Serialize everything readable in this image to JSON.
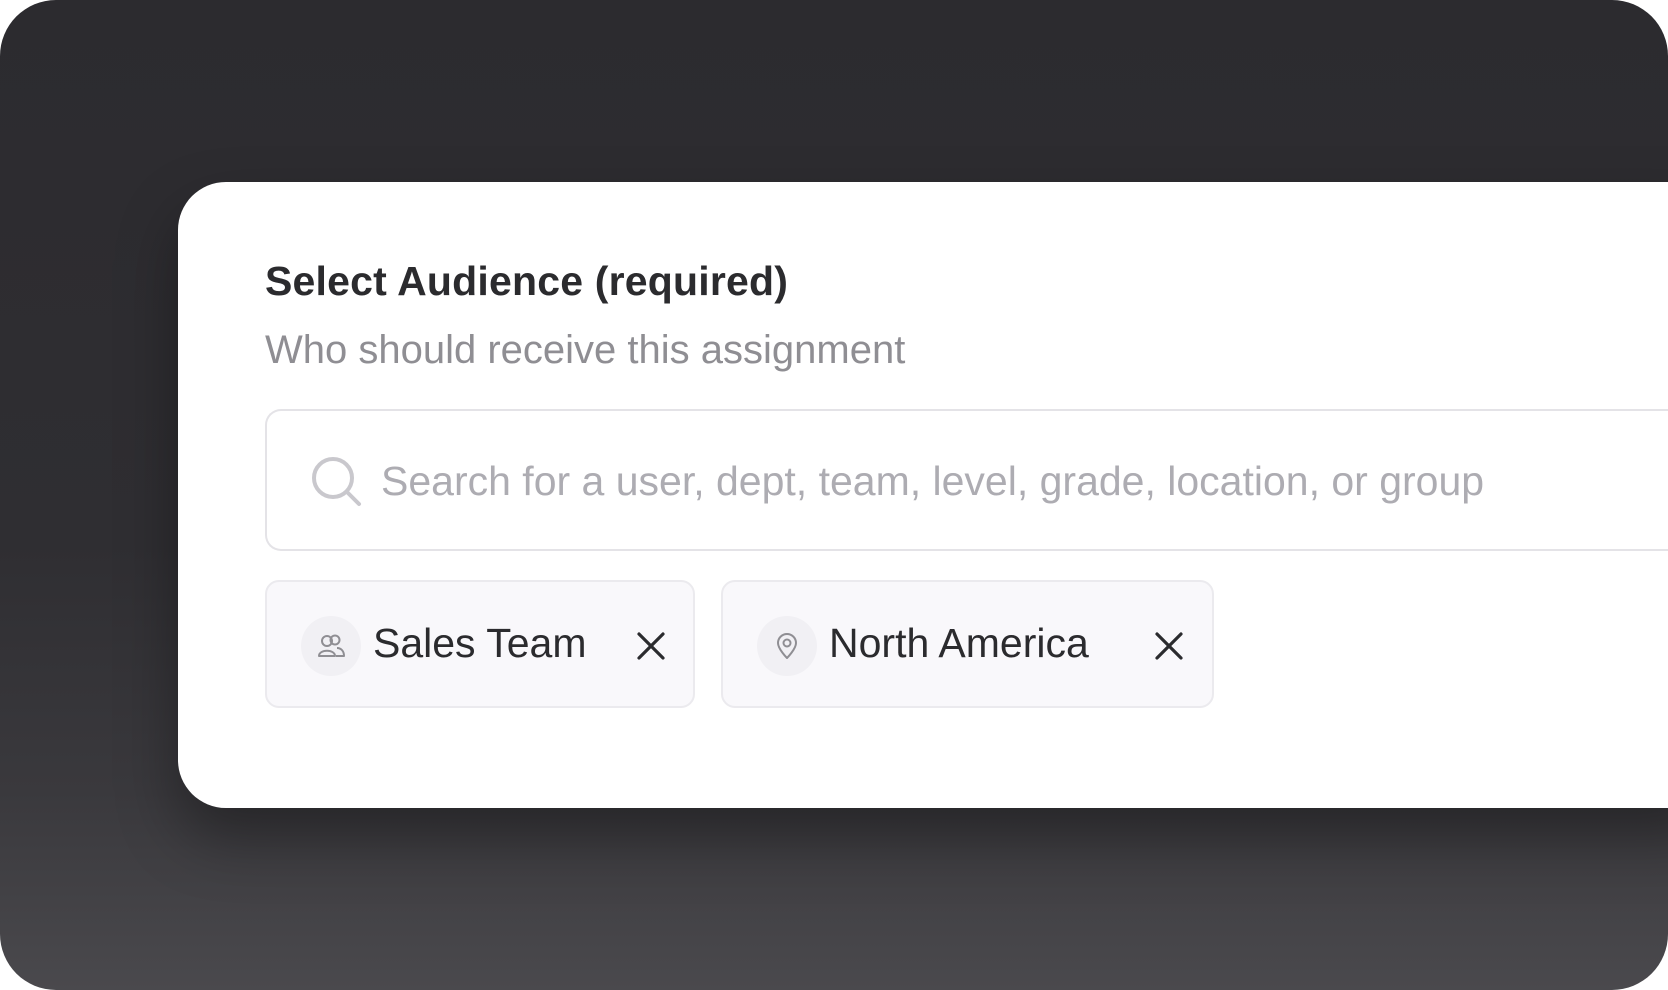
{
  "audience": {
    "title": "Select Audience (required)",
    "subtitle": "Who should receive this assignment",
    "search": {
      "placeholder": "Search for a user, dept, team, level, grade, location, or group",
      "value": "",
      "icon": "search-icon"
    },
    "chips": [
      {
        "label": "Sales Team",
        "icon": "team-icon"
      },
      {
        "label": "North America",
        "icon": "location-pin-icon"
      }
    ]
  },
  "colors": {
    "title": "#2b2b2e",
    "subtitle": "#8f8e93",
    "placeholder": "#adacb2",
    "chip_bg": "#f9f8fb",
    "chip_border": "#ebeaee",
    "backdrop": "#2f2e32"
  }
}
